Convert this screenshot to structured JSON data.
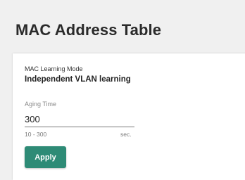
{
  "page": {
    "title": "MAC Address Table"
  },
  "settings": {
    "learning_mode_label": "MAC Learning Mode",
    "learning_mode_value": "Independent VLAN learning",
    "aging_time_label": "Aging Time",
    "aging_time_value": "300",
    "aging_time_range": "10 - 300",
    "aging_time_unit": "sec.",
    "apply_label": "Apply"
  },
  "colors": {
    "background": "#f0f0f0",
    "card": "#ffffff",
    "accent": "#2e8b76"
  }
}
